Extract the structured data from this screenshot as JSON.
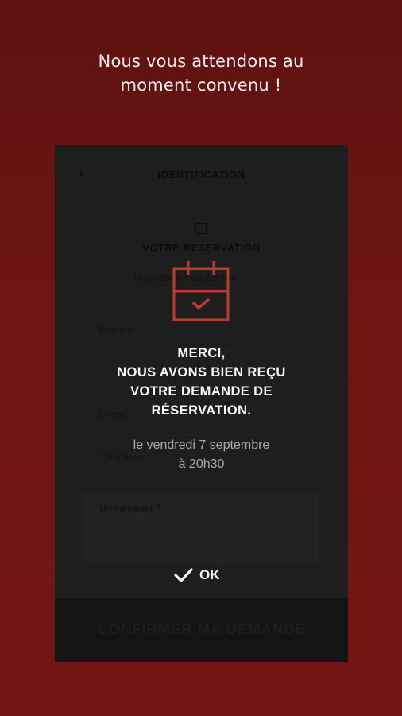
{
  "headline": {
    "line1": "Nous vous attendons au",
    "line2": "moment convenu !"
  },
  "background_form": {
    "back_icon": "chevron-left-icon",
    "title": "IDENTIFICATION",
    "section_title": "VOTRE RÉSERVATION",
    "section_subtitle": "le vendredi 7 septembre",
    "fields": [
      "Prénom",
      "E-mail",
      "Téléphone"
    ],
    "message_placeholder": "Un message ?",
    "confirm_button": "CONFIRMER MA DEMANDE"
  },
  "modal": {
    "icon": "calendar-check-icon",
    "accent_color": "#c0392b",
    "message_line1": "MERCI,",
    "message_line2": "NOUS AVONS BIEN REÇU",
    "message_line3": "VOTRE DEMANDE DE",
    "message_line4": "RÉSERVATION.",
    "date_line1": "le vendredi 7 septembre",
    "date_line2": "à 20h30",
    "ok_label": "OK",
    "ok_icon": "check-icon"
  }
}
